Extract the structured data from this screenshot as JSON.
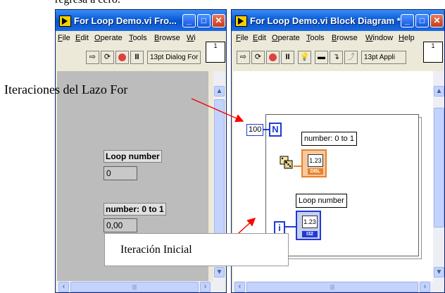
{
  "top_caption": "regresa a cero.",
  "front_panel": {
    "title": "For Loop Demo.vi Fro...",
    "menu": [
      "File",
      "Edit",
      "Operate",
      "Tools",
      "Browse",
      "Wi"
    ],
    "toolbar_font": "13pt Dialog For",
    "pane_icon_text": "1",
    "controls": [
      {
        "label": "Loop number",
        "value": "0"
      },
      {
        "label": "number: 0 to 1",
        "value": "0,00"
      }
    ]
  },
  "block_diagram": {
    "title": "For Loop Demo.vi Block Diagram *",
    "menu": [
      "File",
      "Edit",
      "Operate",
      "Tools",
      "Browse",
      "Window",
      "Help"
    ],
    "toolbar_font": "13pt Appli",
    "pane_icon_text": "1",
    "count_constant": "100",
    "count_terminal": "N",
    "iteration_terminal": "i",
    "indicator_number_label": "number: 0 to 1",
    "indicator_number_value": "1.23",
    "indicator_number_type": "DBL",
    "indicator_loop_label": "Loop number",
    "indicator_loop_value": "1.23",
    "indicator_loop_type": "I32"
  },
  "annotations": {
    "iterations": "Iteraciones del Lazo For",
    "initial": "Iteración Inicial"
  },
  "colors": {
    "title_blue": "#0a5fd8",
    "arrow_red": "#ff0000",
    "terminal_blue": "#1f3bd6",
    "dbl_orange": "#e8822a"
  }
}
